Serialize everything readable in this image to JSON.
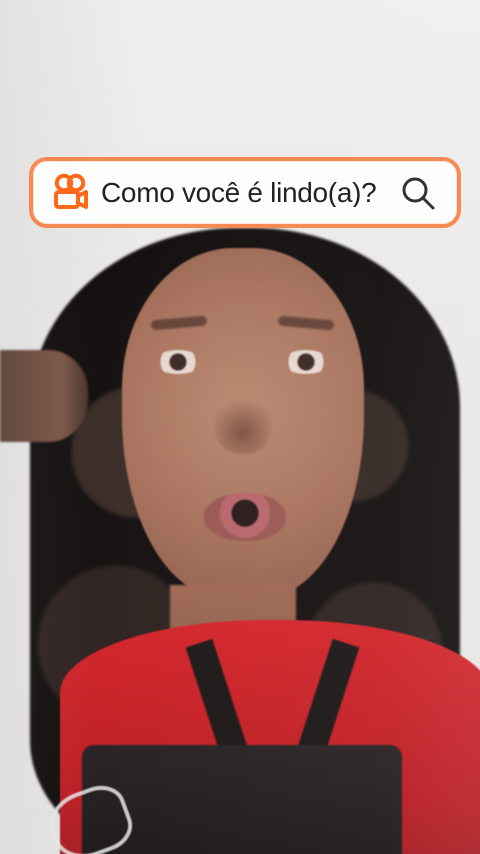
{
  "overlay": {
    "search_query": "Como você é lindo(a)?",
    "brand_icon": "kwai-camera-icon",
    "search_icon": "search-icon",
    "accent_color": "#f68a52"
  },
  "video": {
    "scene": "person-talking-to-camera"
  }
}
